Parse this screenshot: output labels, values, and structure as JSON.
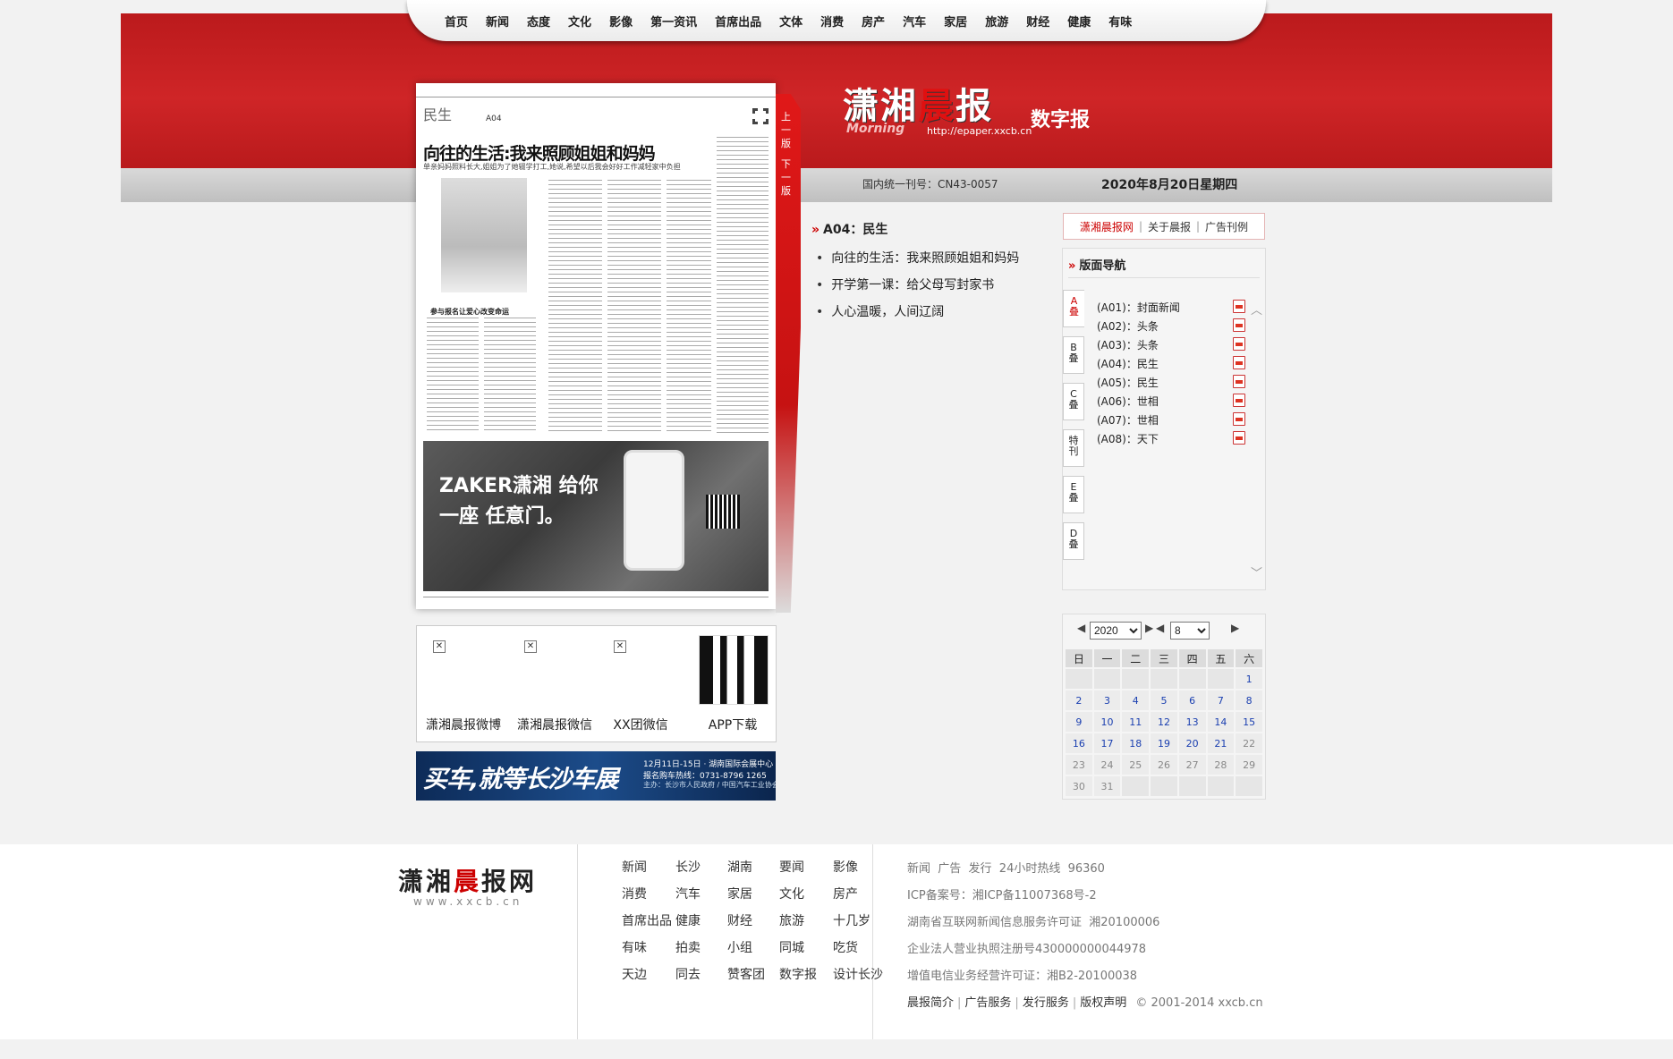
{
  "nav": [
    "首页",
    "新闻",
    "态度",
    "文化",
    "影像",
    "第一资讯",
    "首席出品",
    "文体",
    "消费",
    "房产",
    "汽车",
    "家居",
    "旅游",
    "财经",
    "健康",
    "有味"
  ],
  "masthead": {
    "logo_a": "潇湘",
    "logo_b": "晨",
    "logo_c": "报",
    "logo_en": "Morning",
    "url": "http://epaper.xxcb.cn",
    "subtitle": "数字报",
    "cn_number": "国内统一刊号：CN43-0057",
    "date": "2020年8月20日星期四"
  },
  "paper": {
    "section": "民生",
    "page": "A04",
    "headline": "向往的生活:我来照顾姐姐和妈妈",
    "subhead": "单亲妈妈照料长大,姐姐为了她辍学打工,她说,希望以后我会好好工作减轻家中负担",
    "side_story": "参与报名让爱心改变命运",
    "ad_text": "ZAKER潇湘 给你一座 任意门。",
    "prev_page": "上一版",
    "next_page": "下一版"
  },
  "share": [
    {
      "label": "潇湘晨报微博"
    },
    {
      "label": "潇湘晨报微信"
    },
    {
      "label": "XX团微信"
    },
    {
      "label": "APP下载"
    }
  ],
  "banner": {
    "main": "买车,就等长沙车展",
    "line1": "12月11日-15日 · 湖南国际会展中心",
    "line2": "报名购车热线：0731-8796 1265",
    "line3": "主办：长沙市人民政府 / 中国汽车工业协会"
  },
  "section_title": "A04：民生",
  "articles": [
    "向往的生活：我来照顾姐姐和妈妈",
    "开学第一课：给父母写封家书",
    "人心温暖，人间辽阔"
  ],
  "site_links": [
    "潇湘晨报网",
    "关于晨报",
    "广告刊例"
  ],
  "page_nav": {
    "title": "版面导航",
    "tabs": [
      "A叠",
      "B叠",
      "C叠",
      "特刊",
      "E叠",
      "D叠"
    ],
    "pages": [
      "(A01)：封面新闻",
      "(A02)：头条",
      "(A03)：头条",
      "(A04)：民生",
      "(A05)：民生",
      "(A06)：世相",
      "(A07)：世相",
      "(A08)：天下"
    ]
  },
  "calendar": {
    "year": "2020",
    "month": "8",
    "weekdays": [
      "日",
      "一",
      "二",
      "三",
      "四",
      "五",
      "六"
    ],
    "weeks": [
      [
        "",
        "",
        "",
        "",
        "",
        "",
        "1"
      ],
      [
        "2",
        "3",
        "4",
        "5",
        "6",
        "7",
        "8"
      ],
      [
        "9",
        "10",
        "11",
        "12",
        "13",
        "14",
        "15"
      ],
      [
        "16",
        "17",
        "18",
        "19",
        "20",
        "21",
        "22"
      ],
      [
        "23",
        "24",
        "25",
        "26",
        "27",
        "28",
        "29"
      ],
      [
        "30",
        "31",
        "",
        "",
        "",
        "",
        ""
      ]
    ],
    "linked_through": 21
  },
  "footer": {
    "logo_a": "潇湘",
    "logo_b": "晨",
    "logo_c": "报网",
    "url": "www.xxcb.cn",
    "links": [
      [
        "新闻",
        "长沙",
        "湖南",
        "要闻",
        "影像"
      ],
      [
        "消费",
        "汽车",
        "家居",
        "文化",
        "房产"
      ],
      [
        "首席出品",
        "健康",
        "财经",
        "旅游",
        "十几岁"
      ],
      [
        "有味",
        "拍卖",
        "小组",
        "同城",
        "吃货"
      ],
      [
        "天边",
        "同去",
        "赞客团",
        "数字报",
        "设计长沙"
      ]
    ],
    "info": [
      "新闻  广告  发行  24小时热线  96360",
      "ICP备案号：湘ICP备11007368号-2",
      "湖南省互联网新闻信息服务许可证  湘20100006",
      "企业法人营业执照注册号430000000044978",
      "增值电信业务经营许可证：湘B2-20100038"
    ],
    "bottom_links": [
      "晨报简介",
      "广告服务",
      "发行服务",
      "版权声明"
    ],
    "copyright": "© 2001-2014 xxcb.cn"
  },
  "colors": {
    "brand_red": "#c8201f",
    "link_blue": "#1a3fb0"
  }
}
